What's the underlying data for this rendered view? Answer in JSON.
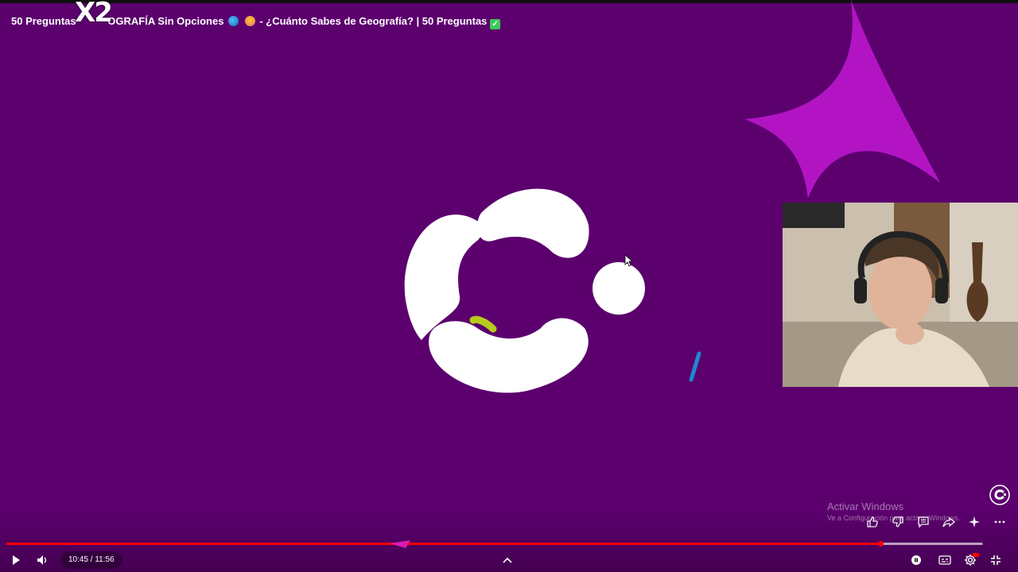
{
  "video": {
    "title_part1": "50 Preguntas",
    "title_part2": "OGRAFÍA Sin Opciones",
    "title_part3": "- ¿Cuánto Sabes de Geografía? | 50 Preguntas",
    "overlay_badge": "X2",
    "current_time": "10:45",
    "duration": "11:56",
    "time_display": "10:45 / 11:56",
    "progress": 0.895,
    "buffered": 0.999
  },
  "watermark": {
    "line1": "Activar Windows",
    "line2": "Ve a Configuración para activar Windows."
  },
  "icons": {
    "play": "play-icon",
    "volume": "volume-icon",
    "expand": "chevron-up-icon",
    "autoplay": "autoplay-toggle-icon",
    "captions": "captions-icon",
    "settings": "gear-icon",
    "exit_fullscreen": "exit-fullscreen-icon",
    "like": "thumbs-up-icon",
    "dislike": "thumbs-down-icon",
    "comment": "comment-icon",
    "share": "share-icon",
    "ask": "sparkle-icon",
    "more": "more-icon"
  },
  "colors": {
    "background": "#5c006e",
    "accent_magenta": "#b214c4",
    "progress_red": "#ff0000",
    "logo_white": "#ffffff",
    "lime": "#b5cc1a",
    "blue": "#1e88d0"
  }
}
